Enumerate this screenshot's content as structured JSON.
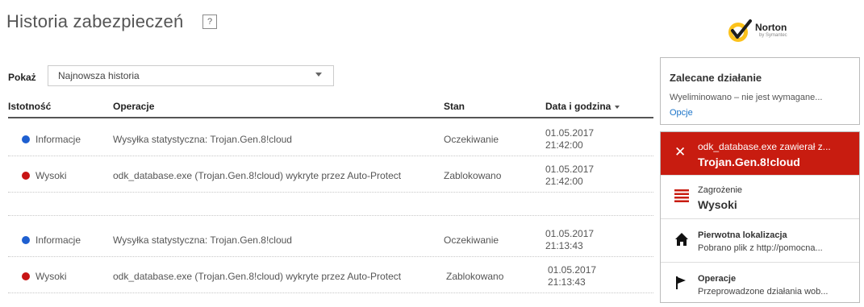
{
  "header": {
    "title": "Historia zabezpieczeń",
    "help_label": "?",
    "logo_text": "Norton",
    "logo_sub": "by Symantec"
  },
  "filter": {
    "label": "Pokaż",
    "selected": "Najnowsza historia"
  },
  "table": {
    "columns": [
      "Istotność",
      "Operacje",
      "Stan",
      "Data i godzina"
    ],
    "rows": [
      {
        "severity": "Informacje",
        "severity_color": "#1e5fd0",
        "operation": "Wysyłka statystyczna: Trojan.Gen.8!cloud",
        "state": "Oczekiwanie",
        "date": "01.05.2017",
        "time": "21:42:00"
      },
      {
        "severity": "Wysoki",
        "severity_color": "#c81414",
        "operation": "odk_database.exe (Trojan.Gen.8!cloud) wykryte przez Auto-Protect",
        "state": "Zablokowano",
        "date": "01.05.2017",
        "time": "21:42:00"
      },
      {
        "severity": "Informacje",
        "severity_color": "#1e5fd0",
        "operation": "Wysyłka statystyczna: Trojan.Gen.8!cloud",
        "state": "Oczekiwanie",
        "date": "01.05.2017",
        "time": "21:13:43"
      },
      {
        "severity": "Wysoki",
        "severity_color": "#c81414",
        "operation": "odk_database.exe (Trojan.Gen.8!cloud) wykryte przez Auto-Protect",
        "state": "Zablokowano",
        "date": "01.05.2017",
        "time": "21:13:43"
      }
    ]
  },
  "recommended": {
    "title": "Zalecane działanie",
    "text": "Wyeliminowano – nie jest wymagane...",
    "link": "Opcje"
  },
  "details": {
    "alert_line1": "odk_database.exe zawierał z...",
    "alert_line2": "Trojan.Gen.8!cloud",
    "threat_label": "Zagrożenie",
    "threat_value": "Wysoki",
    "origin_label": "Pierwotna lokalizacja",
    "origin_value": "Pobrano plik z http://pomocna...",
    "ops_label": "Operacje",
    "ops_value": "Przeprowadzone działania wob..."
  }
}
